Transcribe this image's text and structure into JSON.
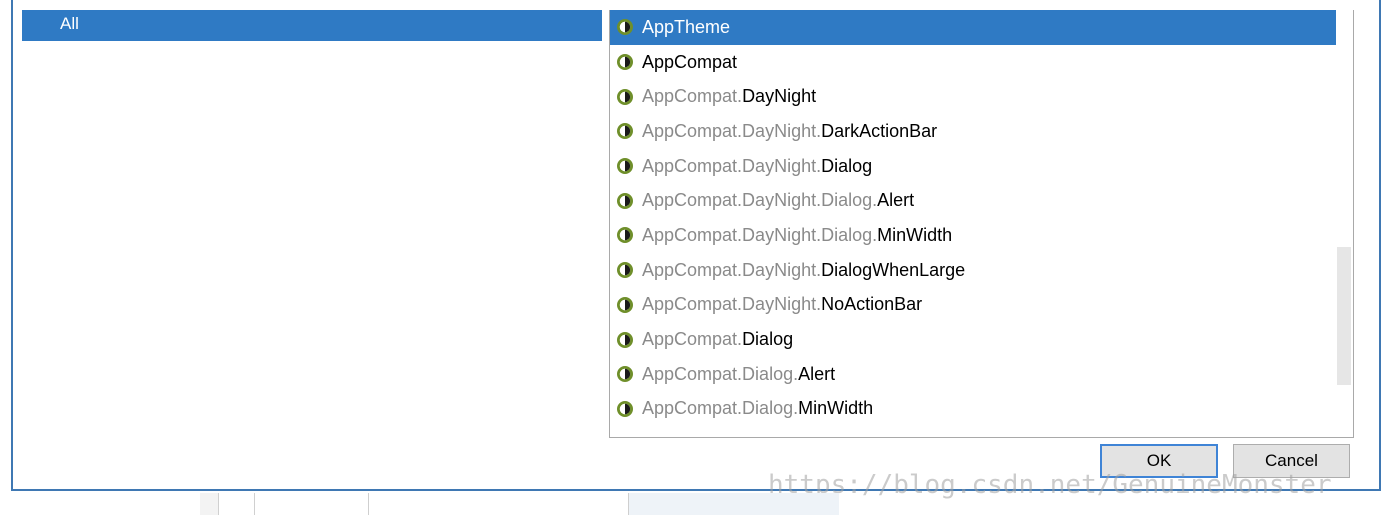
{
  "categories": {
    "items": [
      {
        "label": "All",
        "selected": true
      }
    ]
  },
  "themes": {
    "items": [
      {
        "prefix": "",
        "name": "AppTheme",
        "selected": true,
        "icon": "theme-icon"
      },
      {
        "prefix": "",
        "name": "AppCompat",
        "selected": false,
        "icon": "theme-icon"
      },
      {
        "prefix": "AppCompat.",
        "name": "DayNight",
        "selected": false,
        "icon": "theme-icon"
      },
      {
        "prefix": "AppCompat.DayNight.",
        "name": "DarkActionBar",
        "selected": false,
        "icon": "theme-icon"
      },
      {
        "prefix": "AppCompat.DayNight.",
        "name": "Dialog",
        "selected": false,
        "icon": "theme-icon"
      },
      {
        "prefix": "AppCompat.DayNight.Dialog.",
        "name": "Alert",
        "selected": false,
        "icon": "theme-icon"
      },
      {
        "prefix": "AppCompat.DayNight.Dialog.",
        "name": "MinWidth",
        "selected": false,
        "icon": "theme-icon"
      },
      {
        "prefix": "AppCompat.DayNight.",
        "name": "DialogWhenLarge",
        "selected": false,
        "icon": "theme-icon"
      },
      {
        "prefix": "AppCompat.DayNight.",
        "name": "NoActionBar",
        "selected": false,
        "icon": "theme-icon"
      },
      {
        "prefix": "AppCompat.",
        "name": "Dialog",
        "selected": false,
        "icon": "theme-icon"
      },
      {
        "prefix": "AppCompat.Dialog.",
        "name": "Alert",
        "selected": false,
        "icon": "theme-icon"
      },
      {
        "prefix": "AppCompat.Dialog.",
        "name": "MinWidth",
        "selected": false,
        "icon": "theme-icon"
      }
    ]
  },
  "buttons": {
    "ok_label": "OK",
    "cancel_label": "Cancel"
  },
  "watermark": {
    "text": "https://blog.csdn.net/GenuineMonster"
  },
  "colors": {
    "selection": "#2f7ac4",
    "icon_ring": "#6f8f2a",
    "prefix_text": "#8a8a8a",
    "frame": "#3f78b3"
  }
}
